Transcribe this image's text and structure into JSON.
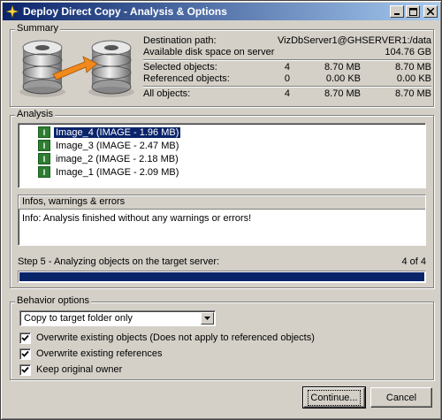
{
  "window": {
    "title": "Deploy Direct Copy - Analysis & Options"
  },
  "summary": {
    "legend": "Summary",
    "destination_label": "Destination path:",
    "destination_value": "VizDbServer1@GHSERVER1:/data",
    "disk_label": "Available disk space on server",
    "disk_value": "104.76 GB",
    "rows": [
      {
        "label": "Selected objects:",
        "count": "4",
        "size1": "8.70 MB",
        "size2": "8.70 MB"
      },
      {
        "label": "Referenced objects:",
        "count": "0",
        "size1": "0.00 KB",
        "size2": "0.00 KB"
      }
    ],
    "total": {
      "label": "All objects:",
      "count": "4",
      "size1": "8.70 MB",
      "size2": "8.70 MB"
    }
  },
  "analysis": {
    "legend": "Analysis",
    "items": [
      {
        "label": "Image_4 (IMAGE - 1.96 MB)",
        "selected": true
      },
      {
        "label": "Image_3 (IMAGE - 2.47 MB)",
        "selected": false
      },
      {
        "label": "image_2 (IMAGE - 2.18 MB)",
        "selected": false
      },
      {
        "label": "Image_1 (IMAGE - 2.09 MB)",
        "selected": false
      }
    ],
    "item_icon_glyph": "I",
    "info_header": "Infos, warnings & errors",
    "info_text": "Info: Analysis finished without any warnings or errors!",
    "step_label": "Step 5 - Analyzing objects on the target server:",
    "step_count": "4 of 4",
    "progress_fraction": 1.0
  },
  "behavior": {
    "legend": "Behavior options",
    "select_value": "Copy to target folder only",
    "options": [
      {
        "label": "Overwrite existing objects (Does not apply to referenced objects)",
        "checked": true
      },
      {
        "label": "Overwrite existing references",
        "checked": true
      },
      {
        "label": "Keep original owner",
        "checked": true
      }
    ]
  },
  "buttons": {
    "continue": "Continue...",
    "cancel": "Cancel"
  },
  "colors": {
    "title_start": "#0a246a",
    "title_end": "#a6caf0",
    "selection": "#0a246a",
    "progress": "#0a246a",
    "image_icon": "#2e7d32"
  }
}
